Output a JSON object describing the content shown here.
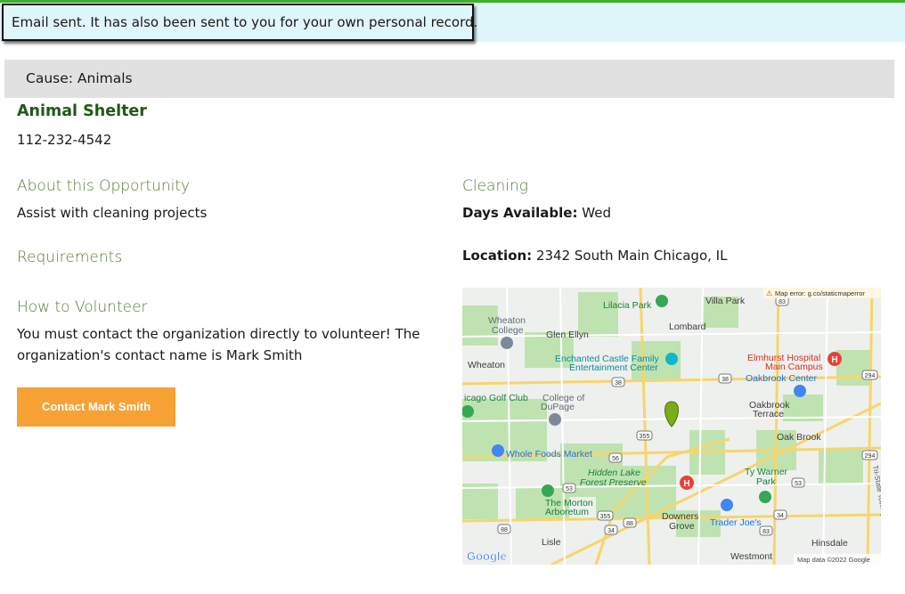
{
  "notice": {
    "message": "Email sent. It has also been sent to you for your own personal record."
  },
  "cause": {
    "label": "Cause: Animals"
  },
  "organization": {
    "name": "Animal Shelter",
    "phone": "112-232-4542"
  },
  "about": {
    "heading": "About this Opportunity",
    "text": "Assist with cleaning projects"
  },
  "requirements": {
    "heading": "Requirements"
  },
  "how_to": {
    "heading": "How to Volunteer",
    "line1": "You must contact the organization directly to volunteer! The",
    "line2": "organization's contact name is Mark Smith",
    "button_label": "Contact Mark Smith"
  },
  "category": {
    "heading": "Cleaning"
  },
  "days": {
    "label": "Days Available:",
    "value": "Wed"
  },
  "location": {
    "label": "Location:",
    "value": "2342 South Main Chicago, IL"
  },
  "map": {
    "error_text": "Map error: g.co/staticmaperror",
    "attribution": "Map data ©2022 Google",
    "logo": "Google",
    "places": {
      "villa_park": "Villa Park",
      "lilacia_park": "Lilacia Park",
      "wheaton_college_1": "Wheaton",
      "wheaton_college_2": "College",
      "glen_ellyn": "Glen Ellyn",
      "lombard": "Lombard",
      "wheaton": "Wheaton",
      "enchanted_1": "Enchanted Castle Family",
      "enchanted_2": "Entertainment Center",
      "elmhurst_1": "Elmhurst Hospital",
      "elmhurst_2": "Main Campus",
      "oakbrook_center": "Oakbrook Center",
      "golf_club": "icago Golf Club",
      "college_dupage_1": "College of",
      "college_dupage_2": "DuPage",
      "oakbrook_terrace_1": "Oakbrook",
      "oakbrook_terrace_2": "Terrace",
      "oak_brook": "Oak Brook",
      "whole_foods": "Whole Foods Market",
      "hidden_lake_1": "Hidden Lake",
      "hidden_lake_2": "Forest Preserve",
      "ty_warner_1": "Ty Warner",
      "ty_warner_2": "Park",
      "morton_1": "The Morton",
      "morton_2": "Arboretum",
      "downers_1": "Downers",
      "downers_2": "Grove",
      "trader_joes": "Trader Joe's",
      "lisle": "Lisle",
      "hinsdale": "Hinsdale",
      "westmont": "Westmont",
      "tri_state": "Tri-State Tollway"
    },
    "shields": {
      "s83a": "83",
      "s38a": "38",
      "s38b": "38",
      "s355a": "355",
      "s56": "56",
      "s53a": "53",
      "s53b": "53",
      "s355b": "355",
      "s88a": "88",
      "s34a": "34",
      "s34b": "34",
      "s83b": "83",
      "s294a": "294",
      "s294b": "294",
      "s88b": "88"
    }
  }
}
